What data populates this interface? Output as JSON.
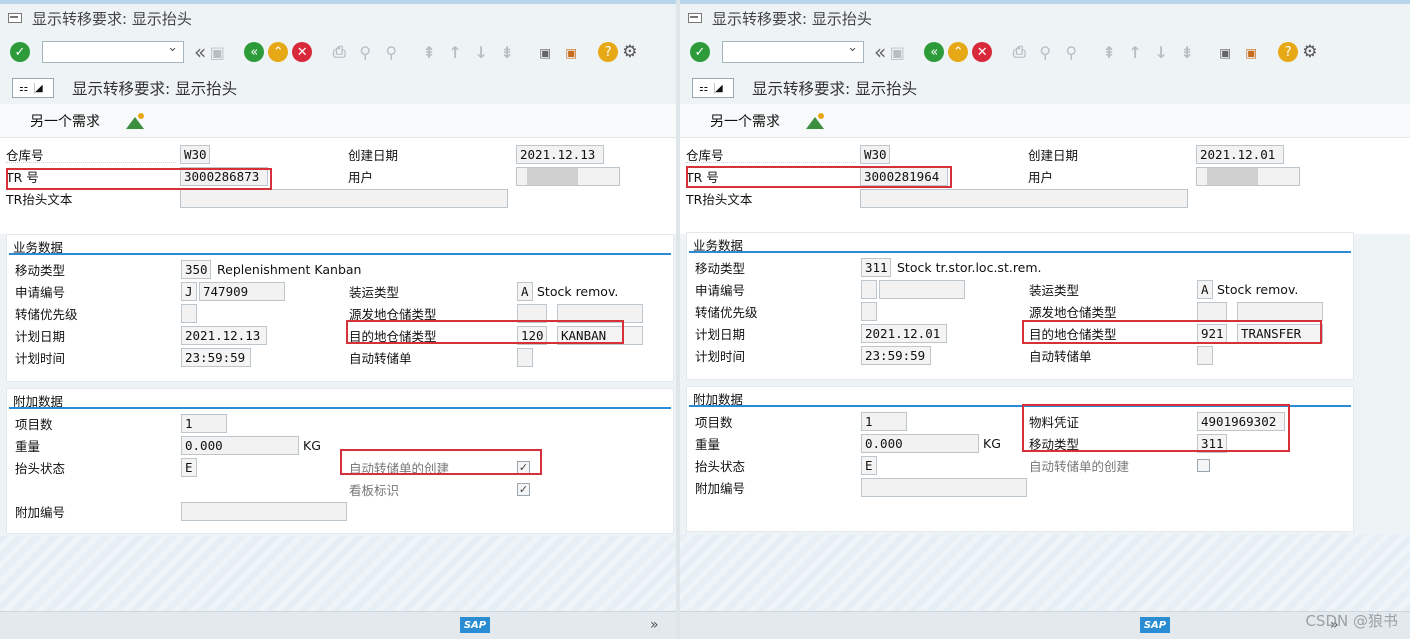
{
  "left": {
    "window_title": "显示转移要求: 显示抬头",
    "screen_title": "显示转移要求: 显示抬头",
    "appbar_button": "另一个需求",
    "header": {
      "warehouse_label": "仓库号",
      "warehouse_value": "W30",
      "tr_label": "TR 号",
      "tr_value": "3000286873",
      "tr_text_label": "TR抬头文本",
      "created_label": "创建日期",
      "created_value": "2021.12.13",
      "user_label": "用户"
    },
    "business": {
      "title": "业务数据",
      "movement_label": "移动类型",
      "movement_code": "350",
      "movement_text": "Replenishment Kanban",
      "request_label": "申请编号",
      "request_prefix": "J",
      "request_value": "747909",
      "priority_label": "转储优先级",
      "plan_date_label": "计划日期",
      "plan_date_value": "2021.12.13",
      "plan_time_label": "计划时间",
      "plan_time_value": "23:59:59",
      "shipping_label": "装运类型",
      "shipping_code": "A",
      "shipping_text": "Stock remov.",
      "source_label": "源发地仓储类型",
      "dest_label": "目的地仓储类型",
      "dest_code": "120",
      "dest_text": "KANBAN",
      "auto_label": "自动转储单"
    },
    "additional": {
      "title": "附加数据",
      "items_label": "项目数",
      "items_value": "1",
      "weight_label": "重量",
      "weight_value": "0.000",
      "weight_unit": "KG",
      "status_label": "抬头状态",
      "status_value": "E",
      "auto_create_label": "自动转储单的创建",
      "kanban_label": "看板标识",
      "extra_label": "附加编号"
    }
  },
  "right": {
    "window_title": "显示转移要求: 显示抬头",
    "screen_title": "显示转移要求: 显示抬头",
    "appbar_button": "另一个需求",
    "header": {
      "warehouse_label": "仓库号",
      "warehouse_value": "W30",
      "tr_label": "TR 号",
      "tr_value": "3000281964",
      "tr_text_label": "TR抬头文本",
      "created_label": "创建日期",
      "created_value": "2021.12.01",
      "user_label": "用户"
    },
    "business": {
      "title": "业务数据",
      "movement_label": "移动类型",
      "movement_code": "311",
      "movement_text": "Stock tr.stor.loc.st.rem.",
      "request_label": "申请编号",
      "priority_label": "转储优先级",
      "plan_date_label": "计划日期",
      "plan_date_value": "2021.12.01",
      "plan_time_label": "计划时间",
      "plan_time_value": "23:59:59",
      "shipping_label": "装运类型",
      "shipping_code": "A",
      "shipping_text": "Stock remov.",
      "source_label": "源发地仓储类型",
      "dest_label": "目的地仓储类型",
      "dest_code": "921",
      "dest_text": "TRANSFER",
      "auto_label": "自动转储单"
    },
    "additional": {
      "title": "附加数据",
      "items_label": "项目数",
      "items_value": "1",
      "weight_label": "重量",
      "weight_value": "0.000",
      "weight_unit": "KG",
      "status_label": "抬头状态",
      "status_value": "E",
      "extra_label": "附加编号",
      "mat_doc_label": "物料凭证",
      "mat_doc_value": "4901969302",
      "mov_type_label": "移动类型",
      "mov_type_value": "311",
      "auto_create_label": "自动转储单的创建"
    }
  },
  "status": {
    "sap_logo": "SAP",
    "watermark": "CSDN @狼书"
  }
}
